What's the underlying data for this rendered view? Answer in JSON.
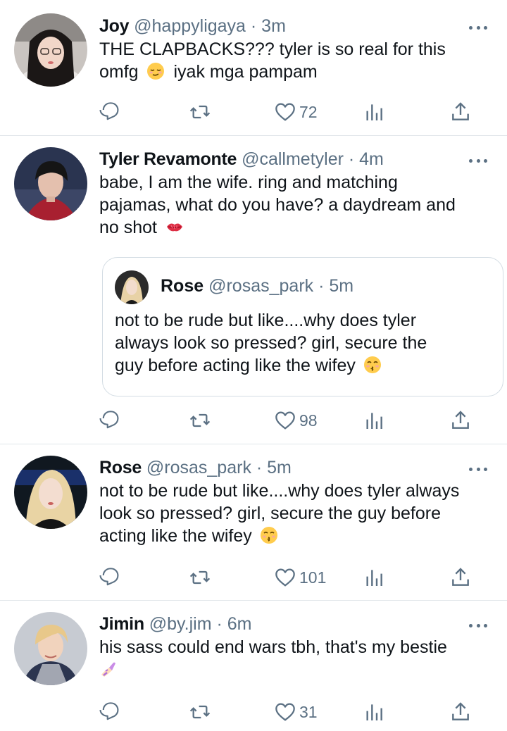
{
  "tweets": [
    {
      "name": "Joy",
      "handle": "@happyligaya",
      "time": "3m",
      "meta": "@happyligaya · 3m",
      "lines": [
        "THE CLAPBACKS??? tyler is so real for this",
        "omfg",
        "iyak mga pampam"
      ],
      "emoji": "relieved-face",
      "likes": "72",
      "replies": "",
      "retweets": ""
    },
    {
      "name": "Tyler Revamonte",
      "handle": "@callmetyler",
      "time": "4m",
      "meta": "@callmetyler · 4m",
      "lines": [
        "babe, I am the wife. ring and matching",
        "pajamas, what do you have? a daydream and",
        "no shot"
      ],
      "emoji": "kiss-mark",
      "likes": "98",
      "quote": {
        "name": "Rose",
        "handle": "@rosas_park",
        "time": "5m",
        "meta": "@rosas_park · 5m",
        "lines": [
          "not to be rude but like....why does tyler",
          "always look so pressed? girl, secure the",
          "guy before acting like the wifey"
        ],
        "emoji": "kissing-face"
      }
    },
    {
      "name": "Rose",
      "handle": "@rosas_park",
      "time": "5m",
      "meta": "@rosas_park · 5m",
      "lines": [
        "not to be rude but like....why does tyler always",
        "look so pressed? girl, secure the guy before",
        "acting like the wifey"
      ],
      "emoji": "kissing-face",
      "likes": "101"
    },
    {
      "name": "Jimin",
      "handle": "@by.jim",
      "time": "6m",
      "meta": "@by.jim · 6m",
      "lines": [
        "his sass could end wars tbh, that's my bestie"
      ],
      "emoji": "nail-polish",
      "likes": "31"
    }
  ],
  "icons": {
    "reply": "reply-icon",
    "retweet": "retweet-icon",
    "like": "heart-icon",
    "analytics": "analytics-icon",
    "share": "share-icon",
    "more": "more-options-icon"
  },
  "colors": {
    "text": "#0f1419",
    "secondary": "#5b7083",
    "divider": "#e1e6ea",
    "quote_border": "#d3dce3"
  }
}
